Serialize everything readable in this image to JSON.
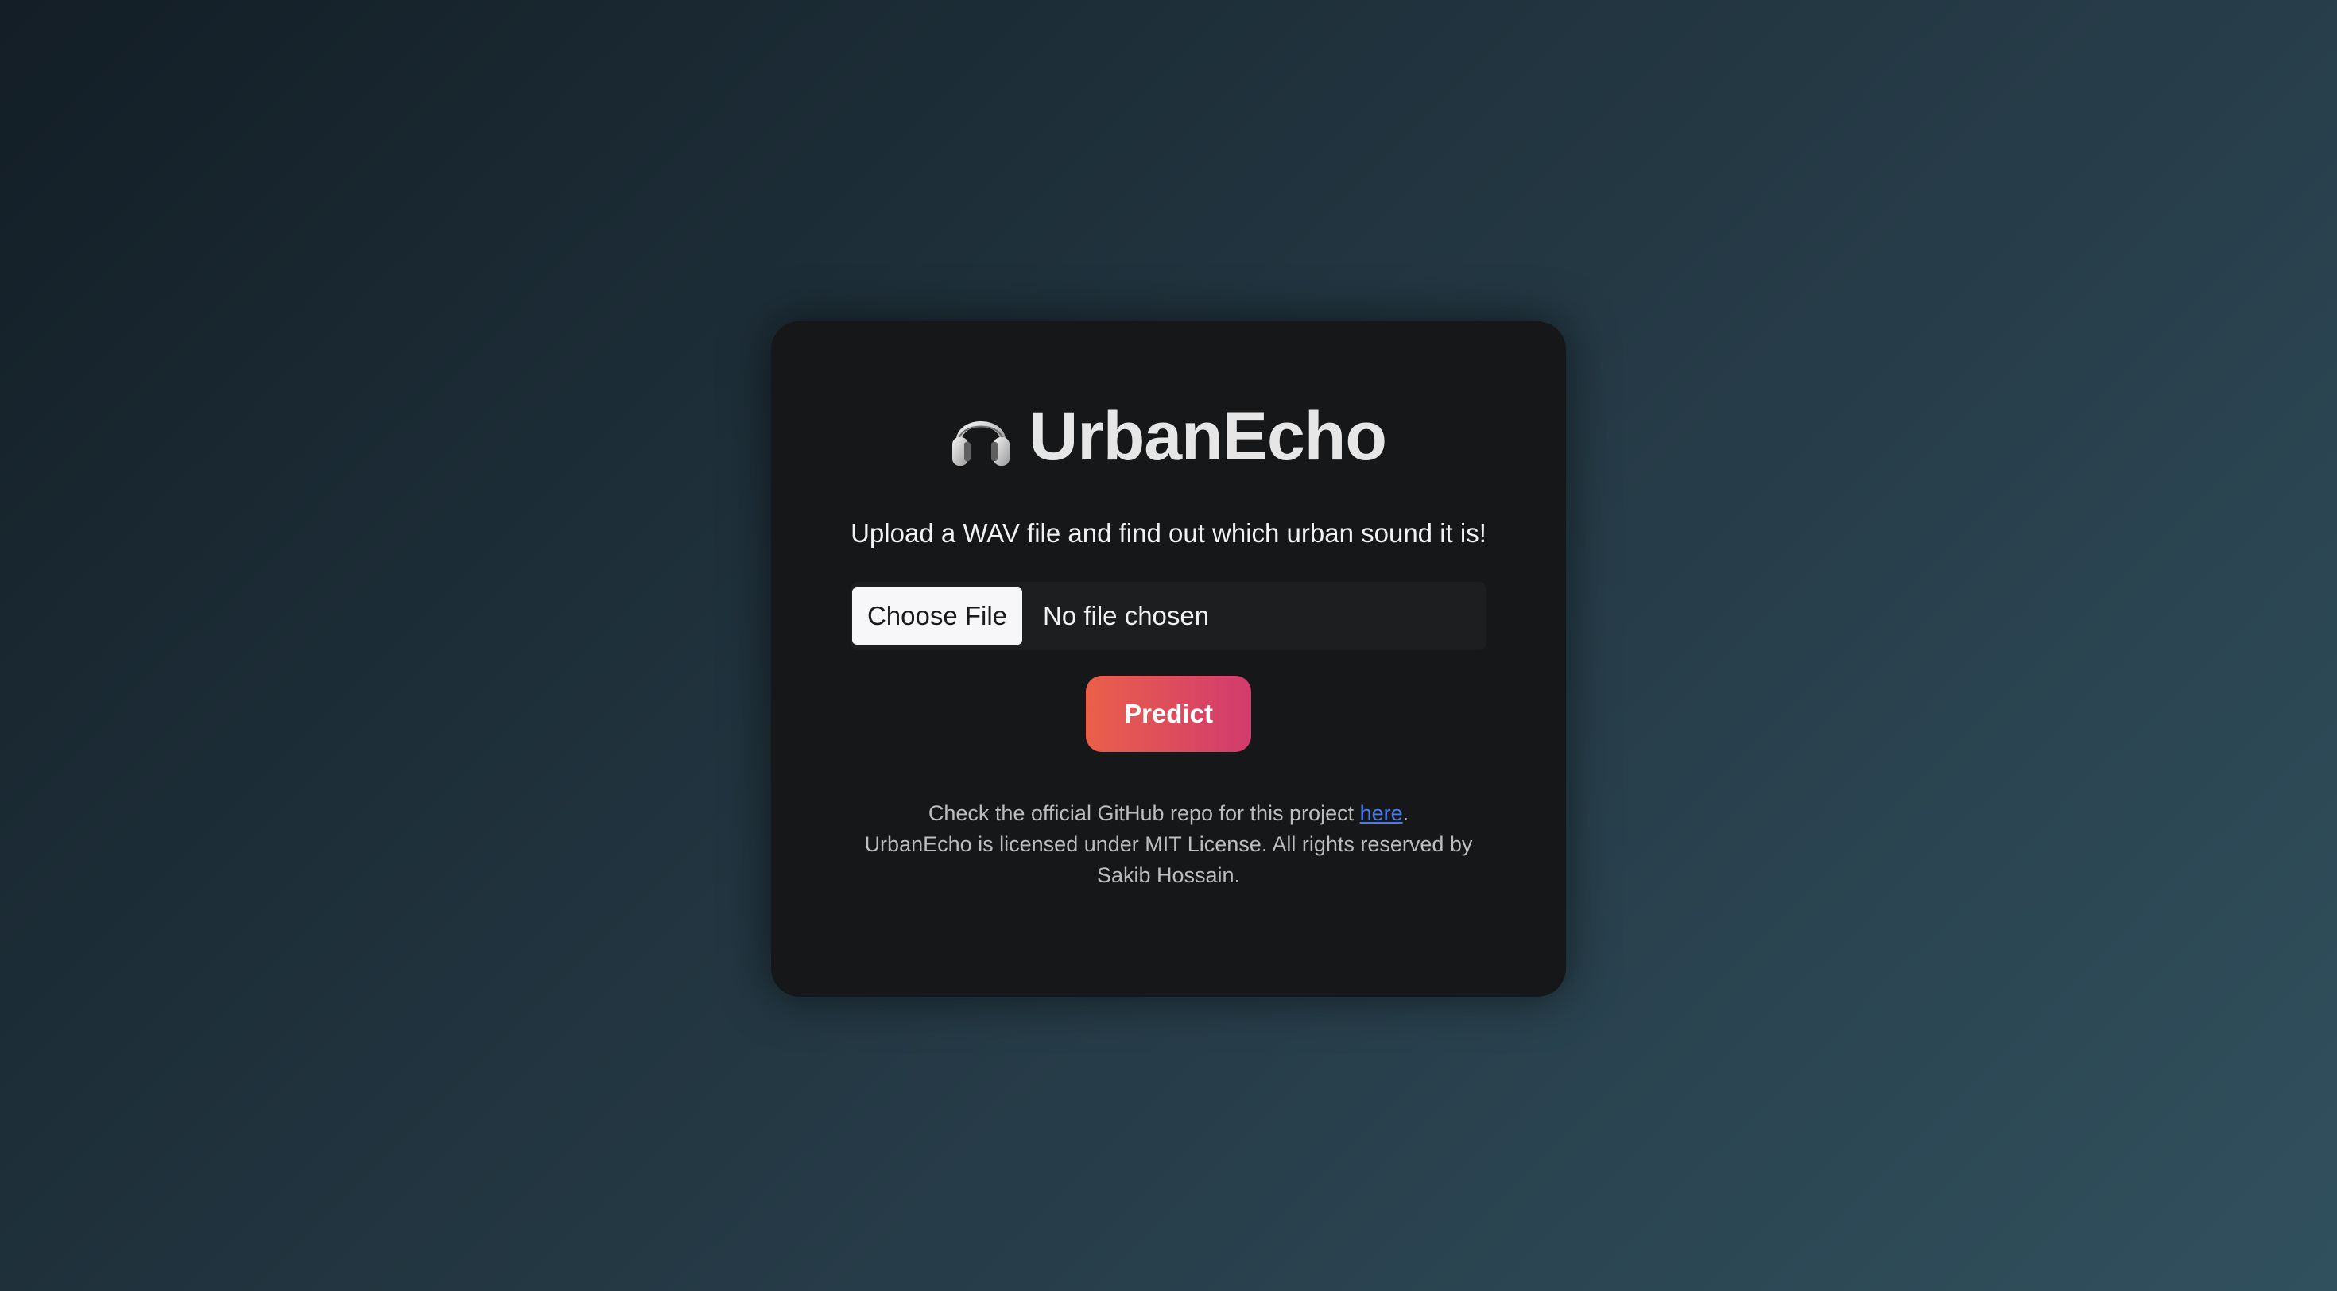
{
  "app": {
    "title": "UrbanEcho",
    "title_icon": "headphones-icon",
    "subtitle": "Upload a WAV file and find out which urban sound it is!"
  },
  "upload": {
    "button_label": "Choose File",
    "status": "No file chosen"
  },
  "actions": {
    "predict_label": "Predict"
  },
  "footer": {
    "repo_prefix": "Check the official GitHub repo for this project ",
    "repo_link_label": "here",
    "repo_suffix": ".",
    "license_line1": "UrbanEcho is licensed under MIT License. All rights reserved by",
    "license_line2": "Sakib Hossain."
  },
  "colors": {
    "card_background": "#161718",
    "predict_gradient_start": "#ea5f4a",
    "predict_gradient_end": "#d13b6e",
    "link": "#4a7bea"
  }
}
